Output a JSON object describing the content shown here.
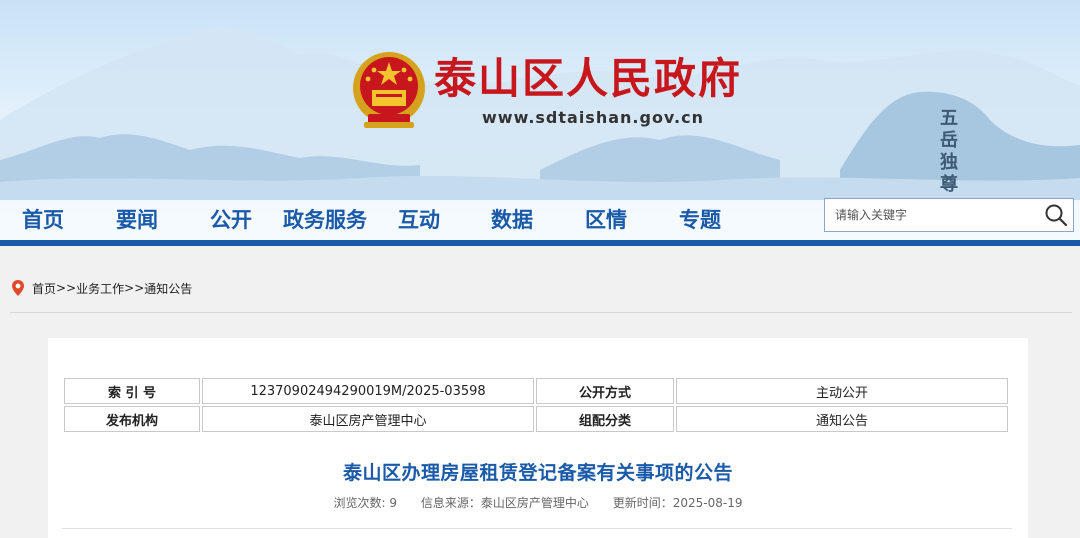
{
  "site": {
    "title": "泰山区人民政府",
    "url": "www.sdtaishan.gov.cn",
    "calligraphy": "五岳独尊"
  },
  "nav": {
    "items": [
      "首页",
      "要闻",
      "公开",
      "政务服务",
      "互动",
      "数据",
      "区情",
      "专题"
    ]
  },
  "search": {
    "placeholder": "请输入关键字"
  },
  "breadcrumb": {
    "home": "首页",
    "sep1": ">>",
    "section": "业务工作",
    "sep2": ">>",
    "current": "通知公告"
  },
  "meta_table": {
    "rows": [
      {
        "label1": "索 引 号",
        "value1": "12370902494290019M/2025-03598",
        "label2": "公开方式",
        "value2": "主动公开"
      },
      {
        "label1": "发布机构",
        "value1": "泰山区房产管理中心",
        "label2": "组配分类",
        "value2": "通知公告"
      }
    ]
  },
  "article": {
    "title": "泰山区办理房屋租赁登记备案有关事项的公告",
    "views_label": "浏览次数:",
    "views": "9",
    "source_label": "信息来源：",
    "source": "泰山区房产管理中心",
    "updated_label": "更新时间：",
    "updated": "2025-08-19"
  },
  "colors": {
    "brand_red": "#c8161d",
    "nav_blue": "#1a5aa8"
  }
}
